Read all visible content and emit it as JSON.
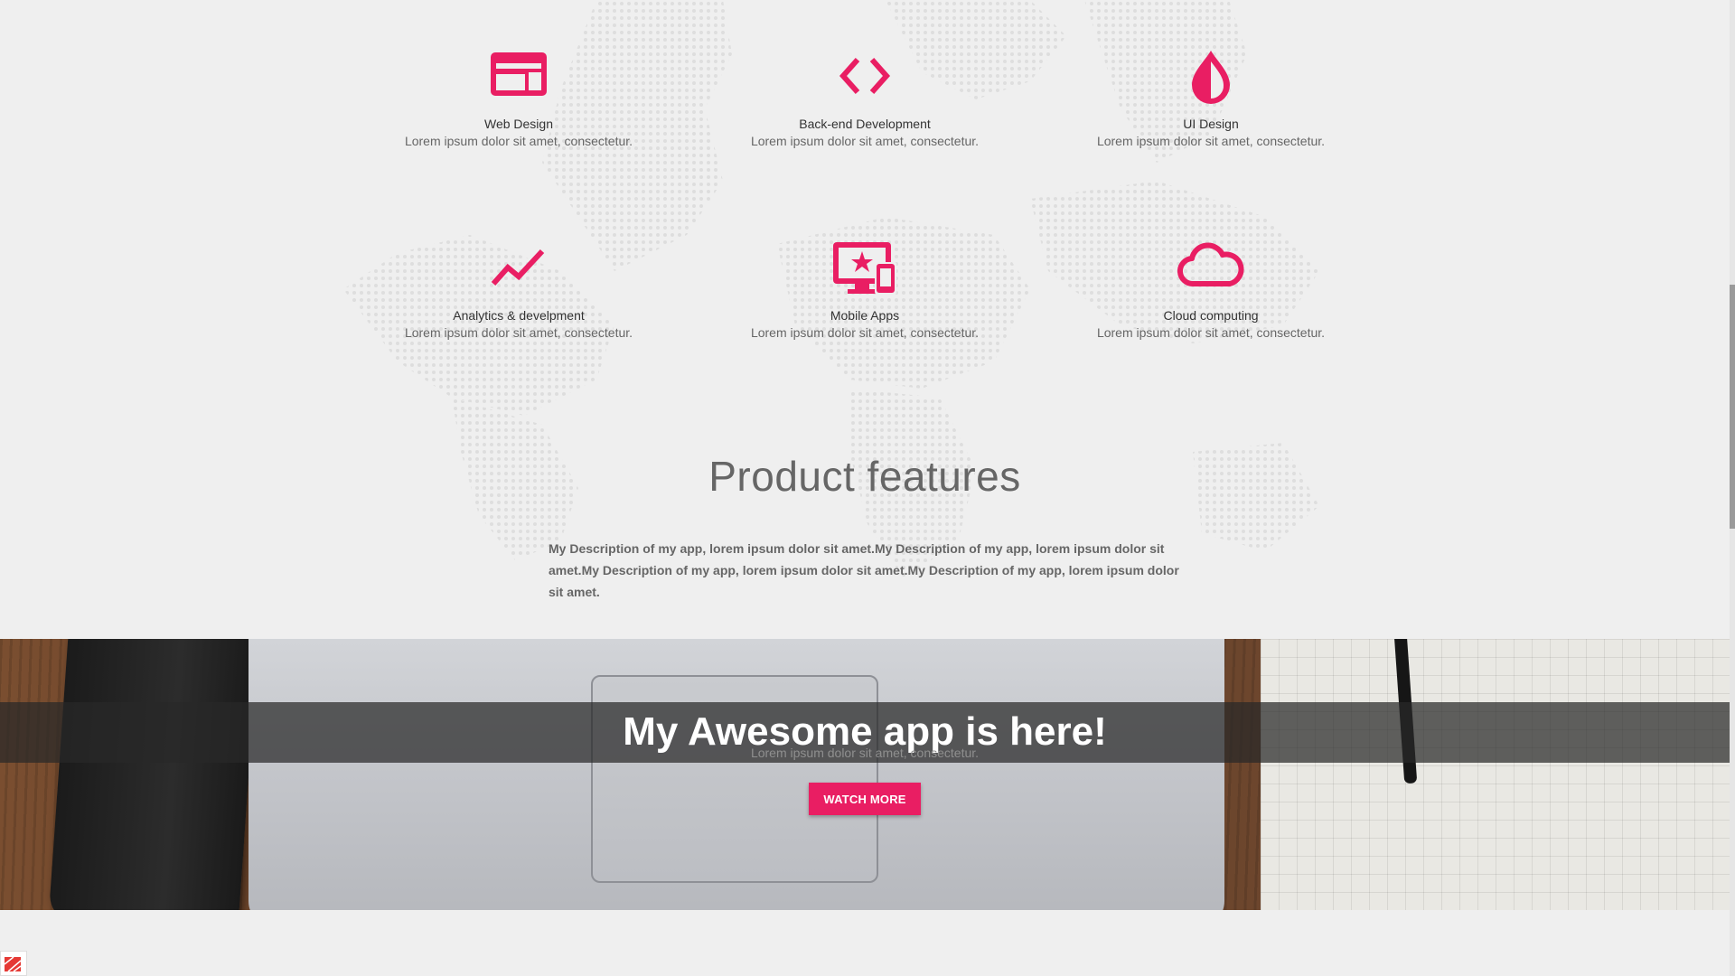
{
  "services": [
    {
      "icon": "web-layout-icon",
      "title": "Web Design",
      "desc": "Lorem ipsum dolor sit amet, consectetur."
    },
    {
      "icon": "code-brackets-icon",
      "title": "Back-end Development",
      "desc": "Lorem ipsum dolor sit amet, consectetur."
    },
    {
      "icon": "ink-drop-icon",
      "title": "UI Design",
      "desc": "Lorem ipsum dolor sit amet, consectetur."
    },
    {
      "icon": "trending-line-icon",
      "title": "Analytics & develpment",
      "desc": "Lorem ipsum dolor sit amet, consectetur."
    },
    {
      "icon": "devices-star-icon",
      "title": "Mobile Apps",
      "desc": "Lorem ipsum dolor sit amet, consectetur."
    },
    {
      "icon": "cloud-icon",
      "title": "Cloud computing",
      "desc": "Lorem ipsum dolor sit amet, consectetur."
    }
  ],
  "features": {
    "title": "Product features",
    "description": "My Description of my app, lorem ipsum dolor sit amet.My Description of my app, lorem ipsum dolor sit amet.My Description of my app, lorem ipsum dolor sit amet.My Description of my app, lorem ipsum dolor sit amet."
  },
  "hero": {
    "title": "My Awesome app is here!",
    "subtitle": "Lorem ipsum dolor sit amet, consectetur.",
    "cta_label": "WATCH MORE"
  },
  "colors": {
    "accent": "#e91e63",
    "background": "#efefef"
  }
}
